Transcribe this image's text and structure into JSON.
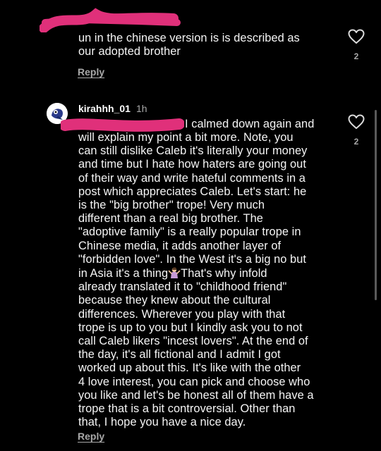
{
  "comment_top": {
    "text": "un in the chinese version is is described as\nour adopted brother",
    "reply_label": "Reply",
    "like_count": "2",
    "heart_icon": "heart-outline-icon"
  },
  "comment_main": {
    "username": "kirahhh_01",
    "time": "1h",
    "text_line1": "I calmed down again and",
    "text_part1": "will explain my point a bit more. Note, you\ncan still dislike Caleb it's literally your money\nand time but I hate how haters are going out\nof their way and write hateful comments in a\npost which appreciates Caleb. Let's start: he\nis the \"big brother\" trope! Very much\ndifferent than a real big brother. The\n\"adoptive family\" is a really popular trope in\nChinese media, it adds another layer of\n\"forbidden love\". In the West it's a big no but\nin Asia it's a thing",
    "text_part2": "That's why infold\nalready translated it to \"childhood friend\"\nbecause they knew about the cultural\ndifferences. Wherever you play with that\ntrope is up to you but I kindly ask you to not\ncall Caleb likers \"incest lovers\". At the end of\nthe day, it's all fictional and I admit I got\nworked up about this. It's like with the other\n4 love interest, you can pick and choose who\nyou like and let's be honest all of them have a\ntrope that is a bit controversial. Other than\nthat, I hope you have a nice day.",
    "reply_label": "Reply",
    "like_count": "2",
    "emoji": "person-shrugging-emoji",
    "heart_icon": "heart-outline-icon"
  },
  "colors": {
    "background": "#000000",
    "text": "#f5f5f5",
    "muted": "#a8a8a8",
    "redaction": "#e0307a"
  }
}
